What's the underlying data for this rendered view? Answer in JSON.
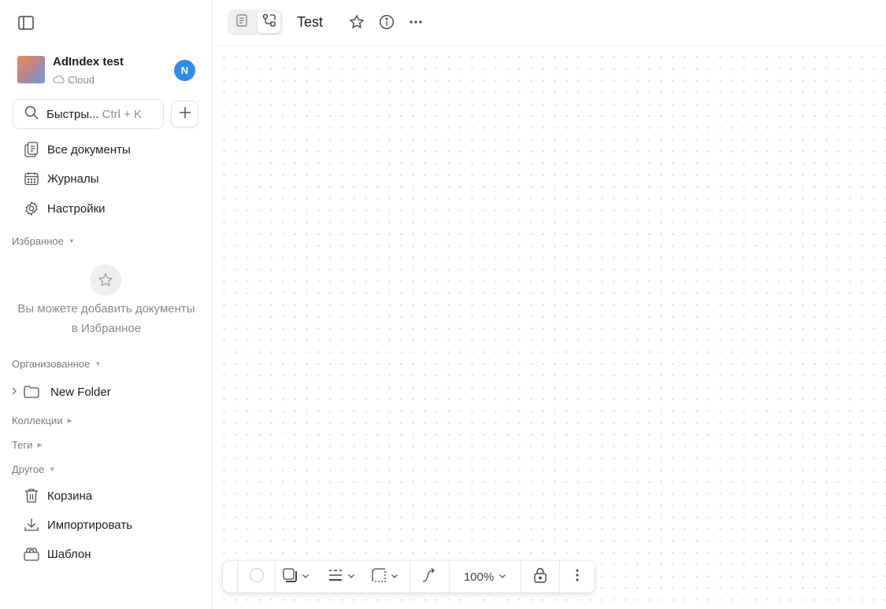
{
  "workspace": {
    "name": "AdIndex test",
    "storage": "Cloud",
    "user_initial": "N"
  },
  "search": {
    "label": "Быстры...",
    "shortcut": "Ctrl + K"
  },
  "nav": [
    {
      "label": "Все документы",
      "icon": "all-docs-icon"
    },
    {
      "label": "Журналы",
      "icon": "calendar-icon"
    },
    {
      "label": "Настройки",
      "icon": "gear-icon"
    }
  ],
  "sections": {
    "favorites": "Избранное",
    "organized": "Организованное",
    "collections": "Коллекции",
    "tags": "Теги",
    "other": "Другое"
  },
  "favorites_empty": {
    "line1": "Вы можете добавить документы",
    "line2": "в Избранное"
  },
  "folders": [
    {
      "label": "New Folder"
    }
  ],
  "other_items": [
    {
      "label": "Корзина",
      "icon": "trash-icon"
    },
    {
      "label": "Импортировать",
      "icon": "import-icon"
    },
    {
      "label": "Шаблон",
      "icon": "template-icon"
    }
  ],
  "document": {
    "title": "Test"
  },
  "toolbar": {
    "zoom": "100%"
  }
}
